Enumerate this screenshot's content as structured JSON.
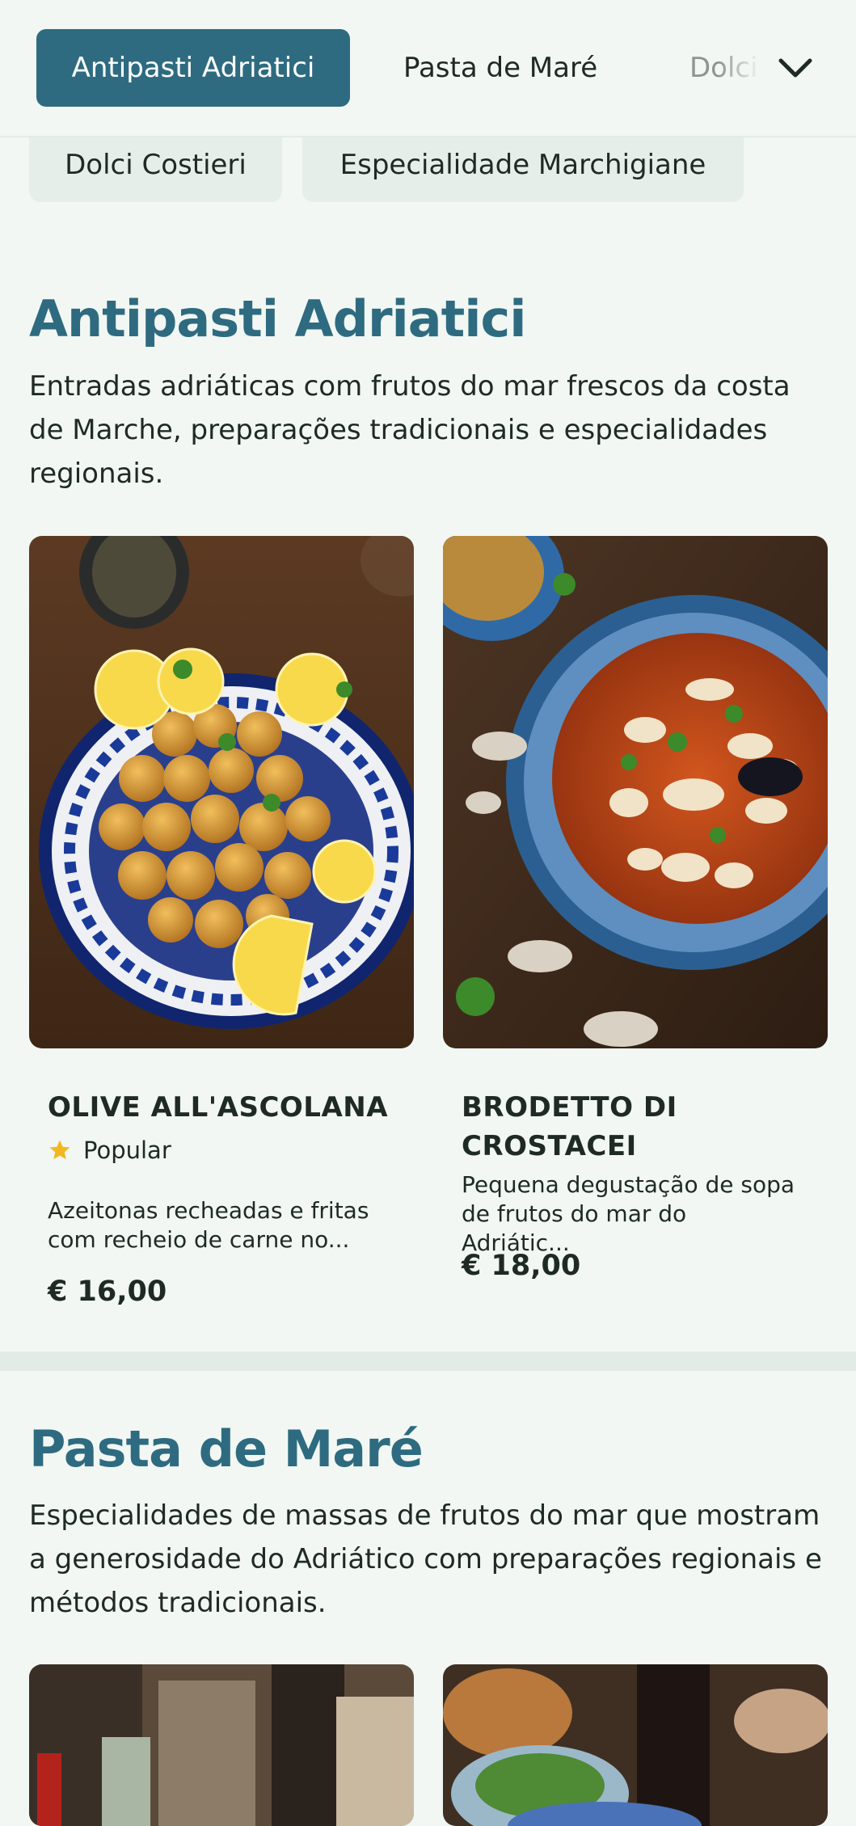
{
  "nav": {
    "tabs": [
      {
        "label": "Antipasti Adriatici",
        "active": true
      },
      {
        "label": "Pasta de Maré",
        "active": false
      },
      {
        "label": "Dolci Costieri",
        "active": false
      }
    ],
    "more_icon": "chevron-down-icon",
    "pills": [
      "Dolci Costieri",
      "Especialidade Marchigiane"
    ]
  },
  "sections": [
    {
      "title": "Antipasti Adriatici",
      "description": "Entradas adriáticas com frutos do mar frescos da costa de Marche, preparações tradicionais e especialidades regionais.",
      "items": [
        {
          "name": "OLIVE ALL'ASCOLANA",
          "badge": "Popular",
          "description": "Azeitonas recheadas e fritas com recheio de carne no...",
          "price": "€ 16,00"
        },
        {
          "name": "BRODETTO DI CROSTACEI",
          "description": "Pequena degustação de sopa de frutos do mar do Adriátic...",
          "price": "€ 18,00"
        }
      ]
    },
    {
      "title": "Pasta de Maré",
      "description": "Especialidades de massas de frutos do mar que mostram a generosidade do Adriático com preparações regionais e métodos tradicionais."
    }
  ],
  "colors": {
    "accent": "#2e6b80",
    "background": "#f2f7f3",
    "star": "#f3b81f"
  }
}
